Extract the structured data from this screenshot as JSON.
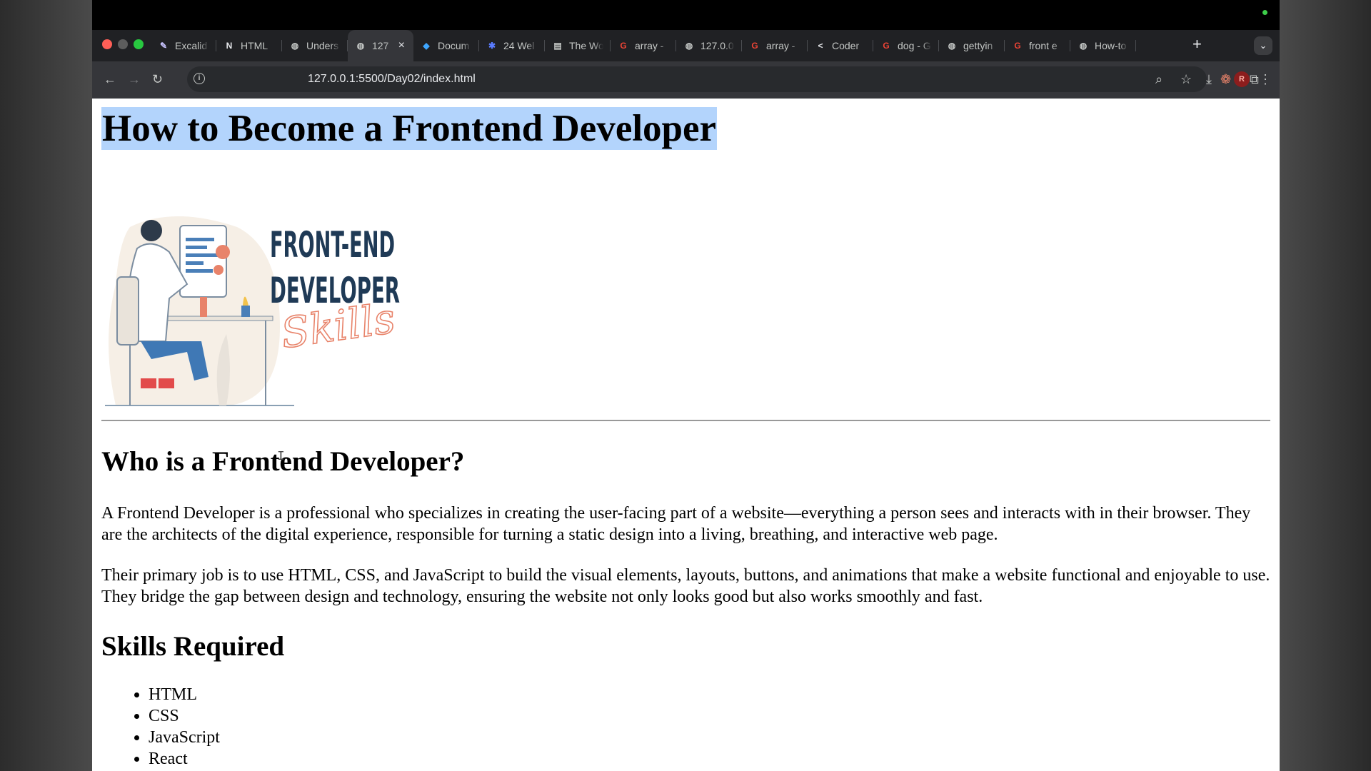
{
  "browser": {
    "tabs": [
      {
        "title": "Excalid",
        "icon": "excalidraw-icon",
        "active": false
      },
      {
        "title": "HTML",
        "icon": "notion-icon",
        "active": false
      },
      {
        "title": "Unders",
        "icon": "globe-icon",
        "active": false
      },
      {
        "title": "127",
        "icon": "globe-icon",
        "active": true
      },
      {
        "title": "Docum",
        "icon": "vscode-icon",
        "active": false
      },
      {
        "title": "24 Wel",
        "icon": "asterisk-icon",
        "active": false
      },
      {
        "title": "The Wo",
        "icon": "book-icon",
        "active": false
      },
      {
        "title": "array -",
        "icon": "google-icon",
        "active": false
      },
      {
        "title": "127.0.0",
        "icon": "globe-icon",
        "active": false
      },
      {
        "title": "array -",
        "icon": "google-icon",
        "active": false
      },
      {
        "title": "Coder",
        "icon": "coder-icon",
        "active": false
      },
      {
        "title": "dog - G",
        "icon": "google-icon",
        "active": false
      },
      {
        "title": "gettyin",
        "icon": "globe-icon",
        "active": false
      },
      {
        "title": "front e",
        "icon": "google-icon",
        "active": false
      },
      {
        "title": "How-to",
        "icon": "globe-icon",
        "active": false
      }
    ],
    "new_tab_label": "+",
    "url": "127.0.0.1:5500/Day02/index.html",
    "avatar_initial": "R"
  },
  "page": {
    "title": "How to Become a Frontend Developer",
    "hero_logo_text": [
      "FRONT-END",
      "DEVELOPER",
      "Skills"
    ],
    "section1_heading": "Who is a Frontend Developer?",
    "para1": "A Frontend Developer is a professional who specializes in creating the user-facing part of a website—everything a person sees and interacts with in their browser. They are the architects of the digital experience, responsible for turning a static design into a living, breathing, and interactive web page.",
    "para2": "Their primary job is to use HTML, CSS, and JavaScript to build the visual elements, layouts, buttons, and animations that make a website functional and enjoyable to use. They bridge the gap between design and technology, ensuring the website not only looks good but also works smoothly and fast.",
    "section2_heading": "Skills Required",
    "skills": [
      "HTML",
      "CSS",
      "JavaScript",
      "React"
    ]
  },
  "colors": {
    "selection": "#b3d4fc",
    "tab_strip": "#202124",
    "toolbar": "#35363a",
    "logo_navy": "#1f3a56",
    "logo_accent": "#e8836a"
  }
}
